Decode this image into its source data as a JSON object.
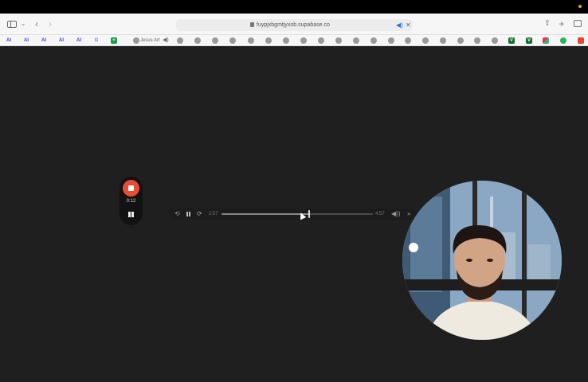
{
  "browser": {
    "url": "fuypjxbgmtjyxob.supabase.co",
    "favorites": [
      {
        "label": "AI",
        "icon": "ai-icon"
      },
      {
        "label": "AI",
        "icon": "ai-icon"
      },
      {
        "label": "AI",
        "icon": "ai-icon"
      },
      {
        "label": "AI",
        "icon": "ai-icon"
      },
      {
        "label": "AI",
        "icon": "ai-icon"
      },
      {
        "label": "G",
        "icon": "google-icon"
      },
      {
        "label": "+",
        "icon": "sheets-icon"
      }
    ],
    "favorite_text": "Jesus Art",
    "speaker": "◀)"
  },
  "recorder": {
    "time": "0:12"
  },
  "player": {
    "current_time": "2:57",
    "duration": "4:57",
    "progress": 0.58,
    "skip_back": "⟲",
    "skip_fwd": "⟳",
    "volume": "◀))",
    "more": "»"
  },
  "colors": {
    "record_red": "#ea4b33",
    "background": "#1f1f1f",
    "link_blue": "#2d6fd6"
  }
}
